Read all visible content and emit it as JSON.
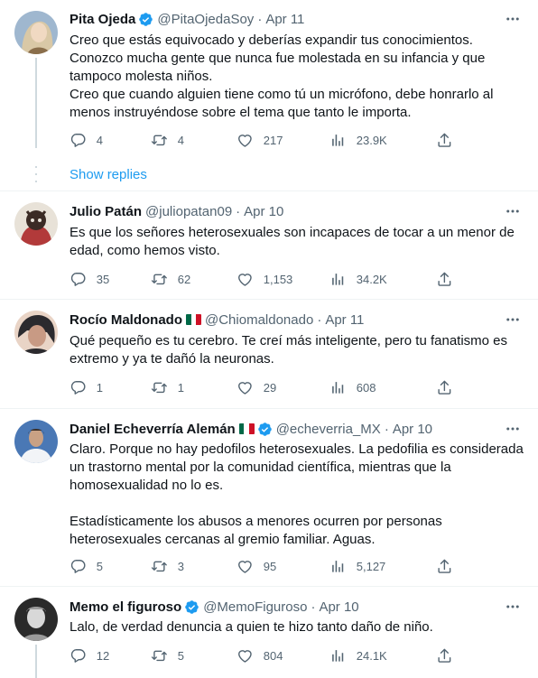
{
  "tweets": [
    {
      "name": "Pita Ojeda",
      "verified": true,
      "flag": false,
      "handle": "@PitaOjedaSoy",
      "date": "Apr 11",
      "text": "Creo que estás equivocado y deberías expandir tus conocimientos.\nConozco mucha gente que nunca fue molestada en su infancia y que tampoco molesta niños.\nCreo que cuando alguien tiene como tú un micrófono, debe honrarlo al menos instruyéndose sobre el tema que tanto le importa.",
      "replies": "4",
      "retweets": "4",
      "likes": "217",
      "views": "23.9K",
      "show_replies": "Show replies",
      "avatar_colors": [
        "#d9c8a6",
        "#f0e2c8",
        "#8a6e4b"
      ]
    },
    {
      "name": "Julio Patán",
      "verified": false,
      "flag": false,
      "handle": "@juliopatan09",
      "date": "Apr 10",
      "text": "Es que los señores heterosexuales son incapaces de tocar a un menor de edad, como hemos visto.",
      "replies": "35",
      "retweets": "62",
      "likes": "1,153",
      "views": "34.2K",
      "avatar_colors": [
        "#3b2b25",
        "#b23a3a",
        "#e8e2d8"
      ]
    },
    {
      "name": "Rocío Maldonado",
      "verified": false,
      "flag": true,
      "handle": "@Chiomaldonado",
      "date": "Apr 11",
      "text": "Qué pequeño es tu cerebro. Te creí más inteligente, pero tu fanatismo es extremo y ya te dañó la neuronas.",
      "replies": "1",
      "retweets": "1",
      "likes": "29",
      "views": "608",
      "avatar_colors": [
        "#2b2a2e",
        "#c89a84",
        "#e9d4c6"
      ]
    },
    {
      "name": "Daniel Echeverría Alemán",
      "verified": true,
      "flag": true,
      "handle": "@echeverria_MX",
      "date": "Apr 10",
      "text": "Claro. Porque no hay pedofilos heterosexuales. La pedofilia es considerada un trastorno mental por la comunidad científica, mientras que la homosexualidad no lo es.\n\nEstadísticamente los abusos a menores ocurren por personas heterosexuales cercanas al gremio familiar. Aguas.",
      "replies": "5",
      "retweets": "3",
      "likes": "95",
      "views": "5,127",
      "avatar_colors": [
        "#4a78b5",
        "#f2f4f7",
        "#c9a184"
      ]
    },
    {
      "name": "Memo el figuroso",
      "verified": true,
      "flag": false,
      "handle": "@MemoFiguroso",
      "date": "Apr 10",
      "text": "Lalo, de verdad denuncia a quien te hizo tanto daño de niño.",
      "replies": "12",
      "retweets": "5",
      "likes": "804",
      "views": "24.1K",
      "avatar_colors": [
        "#2a2a2a",
        "#9a9a9a",
        "#d8d8d8"
      ]
    }
  ],
  "colors": {
    "accent": "#1d9bf0",
    "secondary_text": "#536471",
    "divider": "#eff3f4",
    "flag_green": "#006847",
    "flag_red": "#ce1126"
  },
  "icons": {
    "reply": "speech-bubble-icon",
    "retweet": "retweet-arrows-icon",
    "like": "heart-icon",
    "views": "bar-chart-icon",
    "share": "share-upload-icon",
    "more": "three-dots-icon",
    "verified": "verified-badge-icon"
  }
}
